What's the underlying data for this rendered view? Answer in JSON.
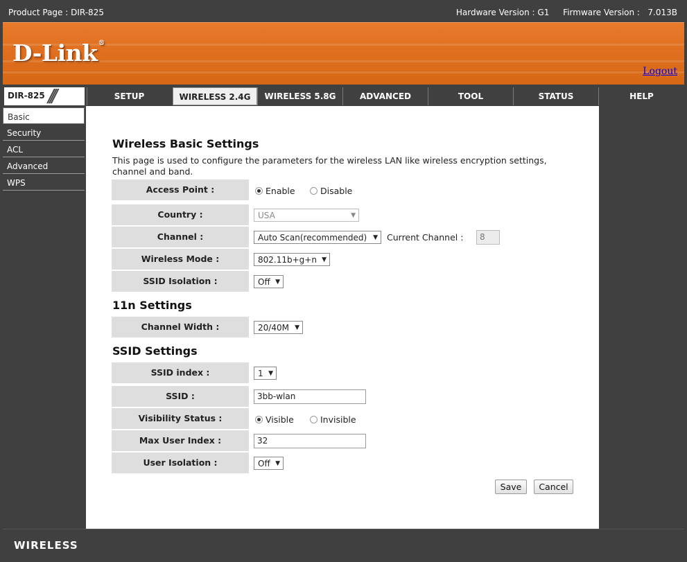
{
  "topbar": {
    "product": "Product Page : DIR-825",
    "hardware": "Hardware Version : G1",
    "firmware": "Firmware Version :   7.013B"
  },
  "banner": {
    "logo": "D-Link",
    "logo_mark": "®",
    "logout": "Logout"
  },
  "model": {
    "name": "DIR-825",
    "slash": "///"
  },
  "tabs": [
    {
      "label": "SETUP"
    },
    {
      "label": "WIRELESS 2.4G"
    },
    {
      "label": "WIRELESS 5.8G"
    },
    {
      "label": "ADVANCED"
    },
    {
      "label": "TOOL"
    },
    {
      "label": "STATUS"
    },
    {
      "label": "HELP"
    }
  ],
  "sidebar": {
    "items": [
      {
        "label": "Basic"
      },
      {
        "label": "Security"
      },
      {
        "label": "ACL"
      },
      {
        "label": "Advanced"
      },
      {
        "label": "WPS"
      }
    ]
  },
  "page": {
    "title": "Wireless Basic Settings",
    "description": "This page is used to configure the parameters for the wireless LAN like wireless encryption settings, channel and band."
  },
  "basic": {
    "access_point": {
      "label": "Access Point :",
      "opt1": "Enable",
      "opt2": "Disable"
    },
    "country": {
      "label": "Country :",
      "value": "USA"
    },
    "channel": {
      "label": "Channel :",
      "value": "Auto Scan(recommended)",
      "current_label": "Current Channel :",
      "current_value": "8"
    },
    "wireless_mode": {
      "label": "Wireless Mode :",
      "value": "802.11b+g+n"
    },
    "ssid_isolation": {
      "label": "SSID Isolation :",
      "value": "Off"
    }
  },
  "n11": {
    "title": "11n Settings",
    "channel_width": {
      "label": "Channel Width :",
      "value": "20/40M"
    }
  },
  "ssid": {
    "title": "SSID Settings",
    "index": {
      "label": "SSID index :",
      "value": "1"
    },
    "ssid": {
      "label": "SSID :",
      "value": "3bb-wlan"
    },
    "visibility": {
      "label": "Visibility Status :",
      "opt1": "Visible",
      "opt2": "Invisible"
    },
    "max_user": {
      "label": "Max User Index :",
      "value": "32"
    },
    "user_isolation": {
      "label": "User Isolation :",
      "value": "Off"
    }
  },
  "buttons": {
    "save": "Save",
    "cancel": "Cancel"
  },
  "footer": {
    "brand": "WIRELESS"
  },
  "icons": {
    "dropdown": "dropdown-arrow-icon"
  },
  "colors": {
    "banner": "#e07020",
    "chrome": "#404040",
    "label_bg": "#dedede"
  }
}
